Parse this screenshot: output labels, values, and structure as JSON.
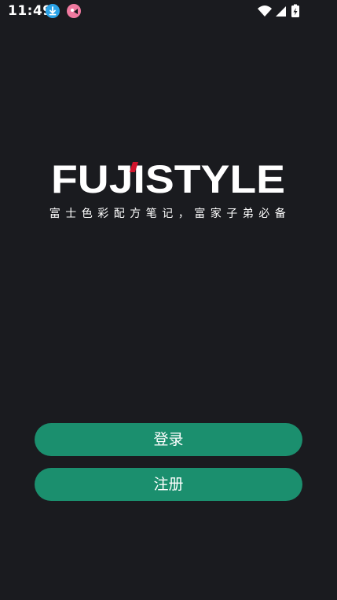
{
  "status_bar": {
    "time": "11:49",
    "icons": [
      "download-icon",
      "app-notification-icon",
      "wifi-icon",
      "signal-icon",
      "battery-charging-icon"
    ]
  },
  "logo": {
    "text": "FUJISTYLE",
    "accent_color": "#d0142c"
  },
  "tagline": "富士色彩配方笔记，富家子弟必备",
  "buttons": {
    "login": "登录",
    "register": "注册"
  },
  "colors": {
    "background": "#1a1b1f",
    "button": "#1b8f6e",
    "text": "#ffffff"
  }
}
